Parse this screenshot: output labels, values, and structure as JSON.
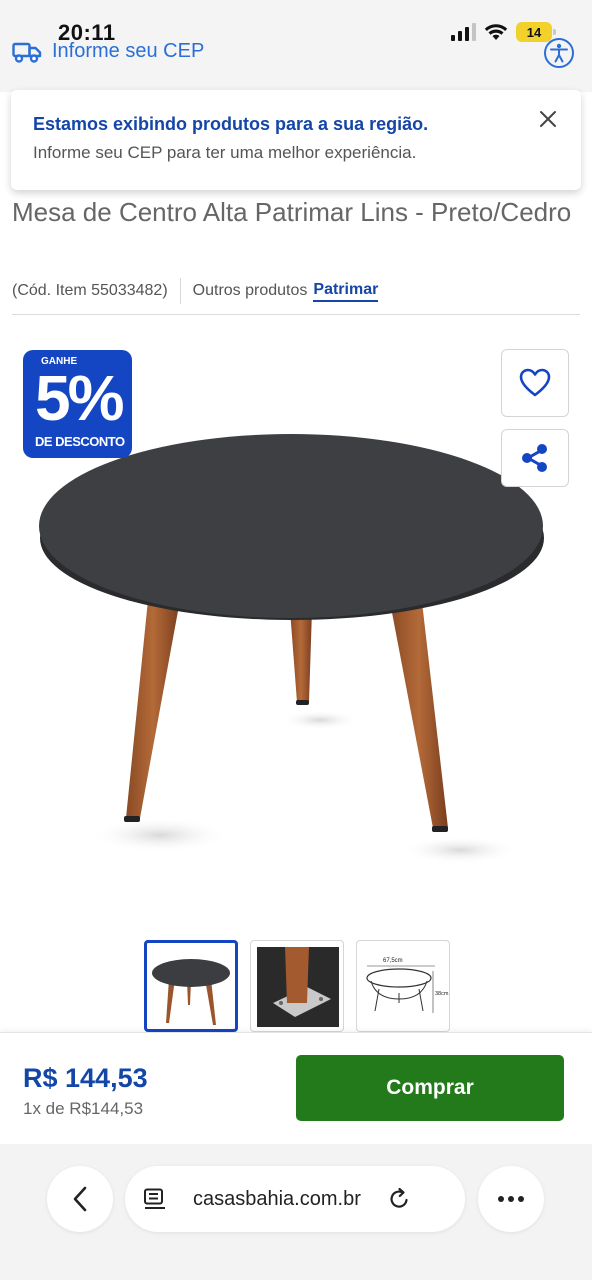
{
  "status_bar": {
    "time": "20:11",
    "battery": "14"
  },
  "header": {
    "cep_label": "Informe seu CEP"
  },
  "notice": {
    "title": "Estamos exibindo produtos para a sua região.",
    "subtitle": "Informe seu CEP para ter uma melhor experiência."
  },
  "product": {
    "title": "Mesa de Centro Alta Patrimar Lins - Preto/Cedro",
    "item_code": "(Cód. Item 55033482)",
    "other_products_label": "Outros produtos",
    "brand": "Patrimar"
  },
  "badge": {
    "top": "GANHE",
    "value": "5%",
    "bottom": "DE DESCONTO"
  },
  "thumb_dims": {
    "width": "67,5cm",
    "height": "38cm"
  },
  "purchase": {
    "price": "R$ 144,53",
    "installment": "1x de R$144,53",
    "buy_label": "Comprar"
  },
  "browser": {
    "url": "casasbahia.com.br"
  },
  "colors": {
    "brand_blue": "#1446a8",
    "badge_blue": "#1446c4",
    "buy_green": "#237a1a",
    "link_blue": "#2b6fd6"
  }
}
